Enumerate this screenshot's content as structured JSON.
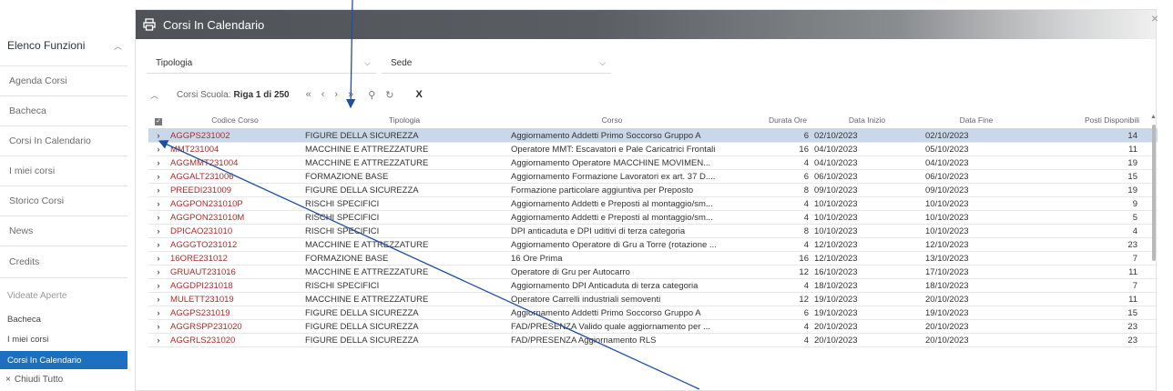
{
  "sidebar": {
    "header": "Elenco Funzioni",
    "items": [
      {
        "label": "Agenda Corsi"
      },
      {
        "label": "Bacheca"
      },
      {
        "label": "Corsi In Calendario"
      },
      {
        "label": "I miei corsi"
      },
      {
        "label": "Storico Corsi"
      },
      {
        "label": "News"
      },
      {
        "label": "Credits"
      }
    ],
    "open_title": "Videate Aperte",
    "open_items": [
      {
        "label": "Bacheca"
      },
      {
        "label": "I miei corsi"
      },
      {
        "label": "Corsi In Calendario"
      }
    ],
    "close_all": "Chiudi Tutto"
  },
  "window": {
    "title": "Corsi In Calendario",
    "close": "×"
  },
  "filters": {
    "tipologia": "Tipologia",
    "sede": "Sede"
  },
  "toolbar": {
    "label": "Corsi Scuola:",
    "position": "Riga 1 di 250"
  },
  "table": {
    "columns": [
      "Codice Corso",
      "Tipologia",
      "Corso",
      "Durata Ore",
      "Data Inizio",
      "Data Fine",
      "Posti Disponibili"
    ],
    "rows": [
      [
        "AGGPS231002",
        "FIGURE DELLA SICUREZZA",
        "Aggiornamento  Addetti Primo Soccorso Gruppo A",
        "6",
        "02/10/2023",
        "02/10/2023",
        "14"
      ],
      [
        "MMT231004",
        "MACCHINE E ATTREZZATURE",
        "Operatore MMT: Escavatori e Pale Caricatrici Frontali",
        "16",
        "04/10/2023",
        "05/10/2023",
        "11"
      ],
      [
        "AGGMMT231004",
        "MACCHINE E ATTREZZATURE",
        "Aggiornamento Operatore MACCHINE MOVIMEN...",
        "4",
        "04/10/2023",
        "04/10/2023",
        "19"
      ],
      [
        "AGGALT231006",
        "FORMAZIONE BASE",
        "Aggiornamento Formazione Lavoratori ex art. 37 D....",
        "6",
        "06/10/2023",
        "06/10/2023",
        "15"
      ],
      [
        "PREEDI231009",
        "FIGURE DELLA SICUREZZA",
        "Formazione particolare aggiuntiva per Preposto",
        "8",
        "09/10/2023",
        "09/10/2023",
        "19"
      ],
      [
        "AGGPON231010P",
        "RISCHI SPECIFICI",
        "Aggiornamento Addetti e Preposti al montaggio/sm...",
        "4",
        "10/10/2023",
        "10/10/2023",
        "9"
      ],
      [
        "AGGPON231010M",
        "RISCHI SPECIFICI",
        "Aggiornamento Addetti e Preposti al montaggio/sm...",
        "4",
        "10/10/2023",
        "10/10/2023",
        "5"
      ],
      [
        "DPICAO231010",
        "RISCHI SPECIFICI",
        "DPI anticaduta e DPI uditivi di terza categoria",
        "8",
        "10/10/2023",
        "10/10/2023",
        "4"
      ],
      [
        "AGGGTO231012",
        "MACCHINE E ATTREZZATURE",
        "Aggiornamento Operatore di Gru a Torre (rotazione ...",
        "4",
        "12/10/2023",
        "12/10/2023",
        "23"
      ],
      [
        "16ORE231012",
        "FORMAZIONE BASE",
        "16 Ore Prima",
        "16",
        "12/10/2023",
        "13/10/2023",
        "7"
      ],
      [
        "GRUAUT231016",
        "MACCHINE E ATTREZZATURE",
        "Operatore di Gru per Autocarro",
        "12",
        "16/10/2023",
        "17/10/2023",
        "11"
      ],
      [
        "AGGDPI231018",
        "RISCHI SPECIFICI",
        "Aggiornamento DPI Anticaduta di terza categoria",
        "4",
        "18/10/2023",
        "18/10/2023",
        "7"
      ],
      [
        "MULETT231019",
        "MACCHINE E ATTREZZATURE",
        "Operatore Carrelli industriali semoventi",
        "12",
        "19/10/2023",
        "20/10/2023",
        "11"
      ],
      [
        "AGGPS231019",
        "FIGURE DELLA SICUREZZA",
        "Aggiornamento  Addetti Primo Soccorso Gruppo A",
        "6",
        "19/10/2023",
        "19/10/2023",
        "15"
      ],
      [
        "AGGRSPP231020",
        "FIGURE DELLA SICUREZZA",
        "FAD/PRESENZA Valido quale aggiornamento per ...",
        "4",
        "20/10/2023",
        "20/10/2023",
        "23"
      ],
      [
        "AGGRLS231020",
        "FIGURE DELLA SICUREZZA",
        "FAD/PRESENZA Aggiornamento RLS",
        "4",
        "20/10/2023",
        "20/10/2023",
        "23"
      ]
    ],
    "selected_row": 0
  },
  "colors": {
    "accent": "#1d6fbf",
    "code_text": "#b22a2a",
    "selected_row": "#c9d8e8",
    "annotation_arrow": "#1f4fa3"
  }
}
